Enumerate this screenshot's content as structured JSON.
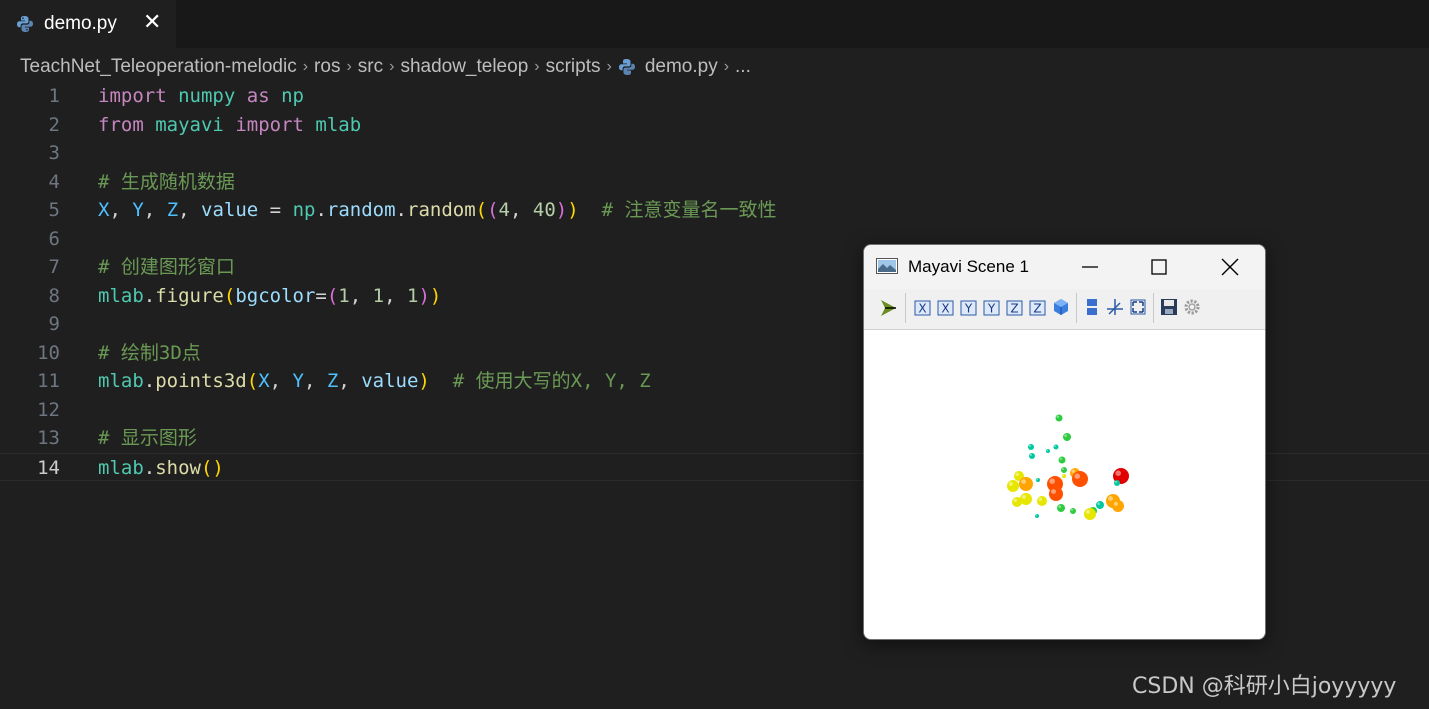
{
  "tab": {
    "filename": "demo.py",
    "close_glyph": "✕",
    "icon": "python-file-icon"
  },
  "breadcrumb": {
    "items": [
      "TeachNet_Teleoperation-melodic",
      "ros",
      "src",
      "shadow_teleop",
      "scripts",
      "demo.py",
      "..."
    ],
    "separator": "›"
  },
  "editor": {
    "lines": [
      {
        "n": "1",
        "tokens": [
          [
            "kw",
            "import"
          ],
          [
            "op",
            " "
          ],
          [
            "mod",
            "numpy"
          ],
          [
            "op",
            " "
          ],
          [
            "kw",
            "as"
          ],
          [
            "op",
            " "
          ],
          [
            "mod",
            "np"
          ]
        ]
      },
      {
        "n": "2",
        "tokens": [
          [
            "kw",
            "from"
          ],
          [
            "op",
            " "
          ],
          [
            "mod",
            "mayavi"
          ],
          [
            "op",
            " "
          ],
          [
            "kw",
            "import"
          ],
          [
            "op",
            " "
          ],
          [
            "mod",
            "mlab"
          ]
        ]
      },
      {
        "n": "3",
        "tokens": []
      },
      {
        "n": "4",
        "tokens": [
          [
            "cm",
            "# 生成随机数据"
          ]
        ]
      },
      {
        "n": "5",
        "tokens": [
          [
            "cst",
            "X"
          ],
          [
            "op",
            ", "
          ],
          [
            "cst",
            "Y"
          ],
          [
            "op",
            ", "
          ],
          [
            "cst",
            "Z"
          ],
          [
            "op",
            ", "
          ],
          [
            "var",
            "value"
          ],
          [
            "op",
            " = "
          ],
          [
            "mod",
            "np"
          ],
          [
            "op",
            "."
          ],
          [
            "var",
            "random"
          ],
          [
            "op",
            "."
          ],
          [
            "fn",
            "random"
          ],
          [
            "p1",
            "("
          ],
          [
            "p2",
            "("
          ],
          [
            "num",
            "4"
          ],
          [
            "op",
            ", "
          ],
          [
            "num",
            "40"
          ],
          [
            "p2",
            ")"
          ],
          [
            "p1",
            ")"
          ],
          [
            "op",
            "  "
          ],
          [
            "cm",
            "# 注意变量名一致性"
          ]
        ]
      },
      {
        "n": "6",
        "tokens": []
      },
      {
        "n": "7",
        "tokens": [
          [
            "cm",
            "# 创建图形窗口"
          ]
        ]
      },
      {
        "n": "8",
        "tokens": [
          [
            "mod",
            "mlab"
          ],
          [
            "op",
            "."
          ],
          [
            "fn",
            "figure"
          ],
          [
            "p1",
            "("
          ],
          [
            "var",
            "bgcolor"
          ],
          [
            "op",
            "="
          ],
          [
            "p2",
            "("
          ],
          [
            "num",
            "1"
          ],
          [
            "op",
            ", "
          ],
          [
            "num",
            "1"
          ],
          [
            "op",
            ", "
          ],
          [
            "num",
            "1"
          ],
          [
            "p2",
            ")"
          ],
          [
            "p1",
            ")"
          ]
        ]
      },
      {
        "n": "9",
        "tokens": []
      },
      {
        "n": "10",
        "tokens": [
          [
            "cm",
            "# 绘制3D点"
          ]
        ]
      },
      {
        "n": "11",
        "tokens": [
          [
            "mod",
            "mlab"
          ],
          [
            "op",
            "."
          ],
          [
            "fn",
            "points3d"
          ],
          [
            "p1",
            "("
          ],
          [
            "cst",
            "X"
          ],
          [
            "op",
            ", "
          ],
          [
            "cst",
            "Y"
          ],
          [
            "op",
            ", "
          ],
          [
            "cst",
            "Z"
          ],
          [
            "op",
            ", "
          ],
          [
            "var",
            "value"
          ],
          [
            "p1",
            ")"
          ],
          [
            "op",
            "  "
          ],
          [
            "cm",
            "# 使用大写的X, Y, Z"
          ]
        ]
      },
      {
        "n": "12",
        "tokens": []
      },
      {
        "n": "13",
        "tokens": [
          [
            "cm",
            "# 显示图形"
          ]
        ]
      },
      {
        "n": "14",
        "tokens": [
          [
            "mod",
            "mlab"
          ],
          [
            "op",
            "."
          ],
          [
            "fn",
            "show"
          ],
          [
            "p1",
            "()"
          ]
        ]
      }
    ],
    "active_line": "14",
    "token_colors": {
      "kw": "#c586c0",
      "mod": "#4ec9b0",
      "var": "#9cdcfe",
      "fn": "#dcdcaa",
      "num": "#b5cea8",
      "cm": "#6a9955",
      "p1": "#ffd700",
      "p2": "#da70d6",
      "op": "#d4d4d4",
      "cst": "#4fc1ff"
    }
  },
  "mayavi": {
    "title": "Mayavi Scene 1",
    "window_controls": [
      "minimize-icon",
      "maximize-icon",
      "close-icon"
    ],
    "toolbar_icons": [
      "mayavi-pipeline-icon",
      "view-plus-x-icon",
      "view-minus-x-icon",
      "view-plus-y-icon",
      "view-minus-y-icon",
      "view-plus-z-icon",
      "view-minus-z-icon",
      "isometric-view-icon",
      "parallel-projection-icon",
      "axes-indicator-icon",
      "full-screen-icon",
      "save-icon",
      "settings-icon"
    ],
    "point_colors": [
      "#2ecc40",
      "#00c8a0",
      "#e6e600",
      "#ffa500",
      "#ff5000",
      "#e00000"
    ]
  },
  "watermark": "CSDN @科研小白joyyyyy"
}
